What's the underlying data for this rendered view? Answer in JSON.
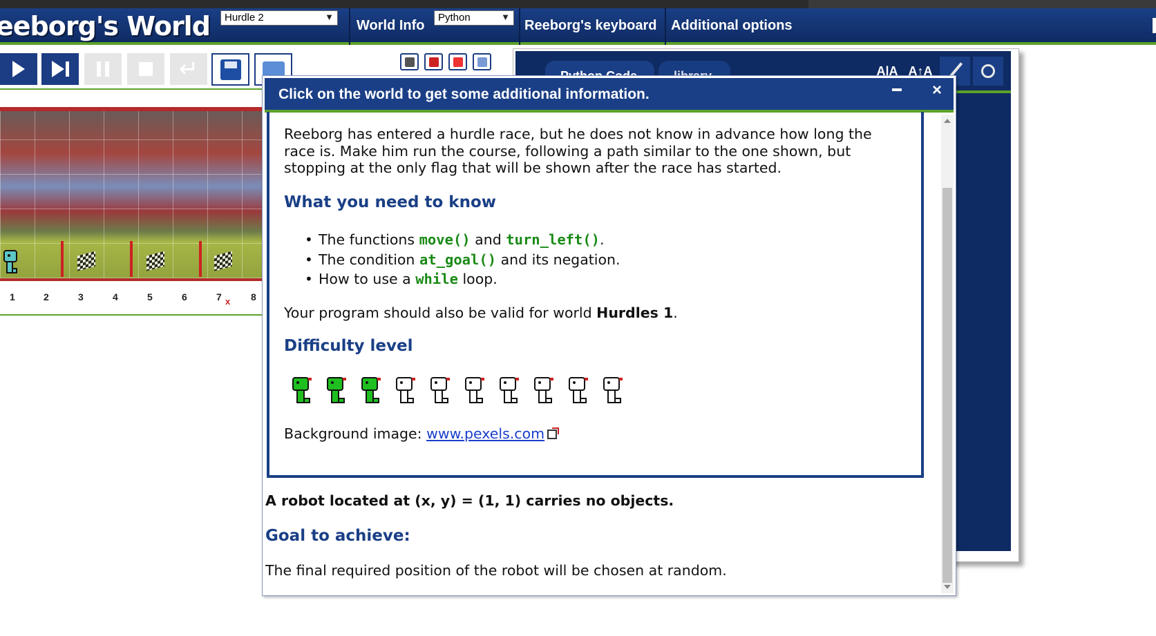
{
  "header": {
    "logo": "eeborg's World",
    "world_select": "Hurdle 2",
    "world_info": "World Info",
    "language_select": "Python",
    "keyboard": "Reeborg's keyboard",
    "additional_options": "Additional options"
  },
  "world": {
    "x_ticks": [
      "1",
      "2",
      "3",
      "4",
      "5",
      "6",
      "7",
      "8"
    ],
    "goal_marker": "x"
  },
  "editor": {
    "tab_code": "Python Code",
    "tab_library": "library",
    "font_decrease": "A|A",
    "font_increase": "A↑A"
  },
  "dialog": {
    "title": "Click on the world to get some additional information.",
    "description": "Reeborg has entered a hurdle race, but he does not know in advance how long the race is. Make him run the course, following a path similar to the one shown, but stopping at the only flag that will be shown after the race has started.",
    "need_to_know_heading": "What you need to know",
    "bullets": {
      "b1_pre": "The functions ",
      "b1_code1": "move()",
      "b1_mid": " and ",
      "b1_code2": "turn_left()",
      "b1_post": ".",
      "b2_pre": "The condition ",
      "b2_code": "at_goal()",
      "b2_post": " and its negation.",
      "b3_pre": "How to use a ",
      "b3_code": "while",
      "b3_post": " loop."
    },
    "valid_pre": "Your program should also be valid for world ",
    "valid_world": "Hurdles 1",
    "valid_post": ".",
    "difficulty_heading": "Difficulty level",
    "difficulty": {
      "filled": 3,
      "total": 10
    },
    "background_label": "Background image: ",
    "background_link": "www.pexels.com",
    "robot_status": "A robot located at (x, y) = (1, 1) carries no objects.",
    "goal_heading": "Goal to achieve:",
    "goal_text": "The final required position of the robot will be chosen at random."
  },
  "colors": {
    "header_blue": "#1a3f86",
    "accent_green": "#5da22a",
    "code_green": "#1a8a16",
    "hurdle_red": "#cc2222"
  }
}
